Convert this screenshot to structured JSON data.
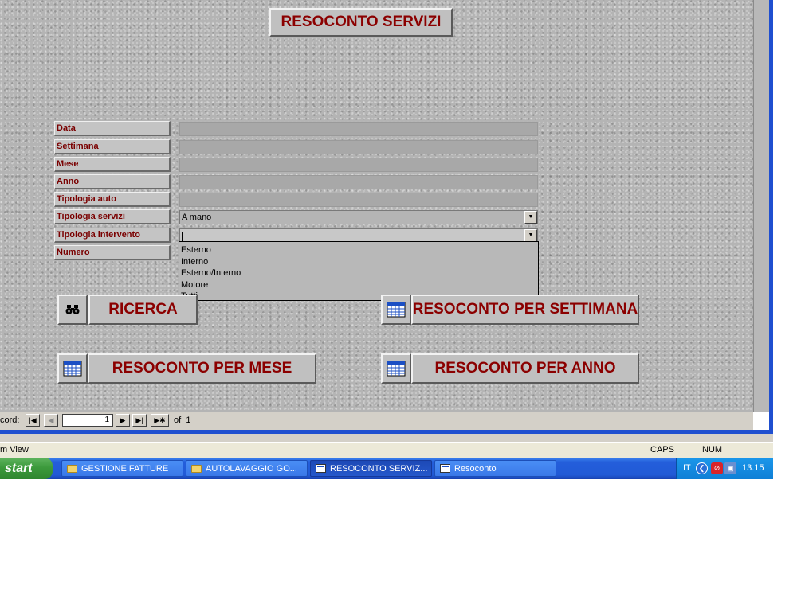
{
  "form": {
    "title": "RESOCONTO SERVIZI",
    "fields": [
      {
        "label": "Data",
        "value": ""
      },
      {
        "label": "Settimana",
        "value": ""
      },
      {
        "label": "Mese",
        "value": ""
      },
      {
        "label": "Anno",
        "value": ""
      },
      {
        "label": "Tipologia auto",
        "value": ""
      },
      {
        "label": "Tipologia servizi",
        "value": "A mano"
      },
      {
        "label": "Tipologia intervento",
        "value": ""
      },
      {
        "label": "Numero",
        "value": ""
      }
    ],
    "dropdown_options": [
      "Esterno",
      "Interno",
      "Esterno/Interno",
      "Motore",
      "Tutti"
    ]
  },
  "buttons": {
    "search": "RICERCA",
    "week": "RESOCONTO PER SETTIMANA",
    "month": "RESOCONTO PER MESE",
    "year": "RESOCONTO PER ANNO"
  },
  "navigator": {
    "label": "cord:",
    "current": "1",
    "of_label": "of",
    "total": "1"
  },
  "status_bar": {
    "left": "m View",
    "caps": "CAPS",
    "num": "NUM"
  },
  "taskbar": {
    "start": "start",
    "items": [
      {
        "label": "GESTIONE FATTURE",
        "icon": "folder-icon"
      },
      {
        "label": "AUTOLAVAGGIO GO...",
        "icon": "folder-icon"
      },
      {
        "label": "RESOCONTO SERVIZ...",
        "icon": "form-icon"
      },
      {
        "label": "Resoconto",
        "icon": "form-icon"
      }
    ],
    "lang": "IT",
    "clock": "13.15"
  }
}
